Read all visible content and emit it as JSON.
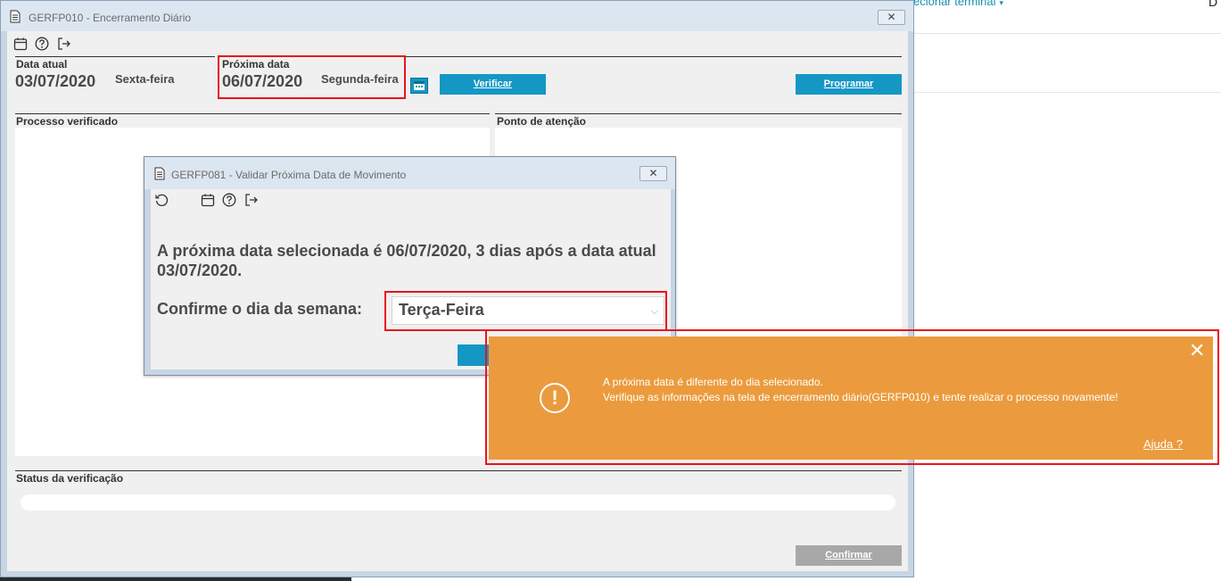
{
  "background": {
    "terminal_menu": "ecionar terminal",
    "right_edge_text": "D"
  },
  "main_window": {
    "title": "GERFP010 - Encerramento Diário",
    "close_label": "✕",
    "data_atual_label": "Data atual",
    "data_atual_value": "03/07/2020",
    "data_atual_day": "Sexta-feira",
    "proxima_data_label": "Próxima data",
    "proxima_data_value": "06/07/2020",
    "proxima_data_day": "Segunda-feira",
    "verificar_button": "Verificar",
    "programar_button": "Programar",
    "processo_label": "Processo verificado",
    "ponto_label": "Ponto de atenção",
    "status_label": "Status da verificação",
    "confirmar_button": "Confirmar"
  },
  "dialog": {
    "title": "GERFP081 - Validar Próxima Data de Movimento",
    "close_label": "✕",
    "message": "A próxima data selecionada é 06/07/2020, 3 dias após a data atual 03/07/2020.",
    "confirm_label": "Confirme o dia da semana:",
    "weekday_selected": "Terça-Feira"
  },
  "toast": {
    "line1": "A próxima data é diferente do dia selecionado.",
    "line2": "Verifique as informações na tela de encerramento diário(GERFP010) e tente realizar o processo novamente!",
    "help_link": "Ajuda ?",
    "close_label": "✕",
    "icon_glyph": "!",
    "color": "#eb9b3d"
  },
  "colors": {
    "accent_button": "#1597c5",
    "highlight_box": "#e8141b",
    "window_frame": "#c7d5e4"
  }
}
